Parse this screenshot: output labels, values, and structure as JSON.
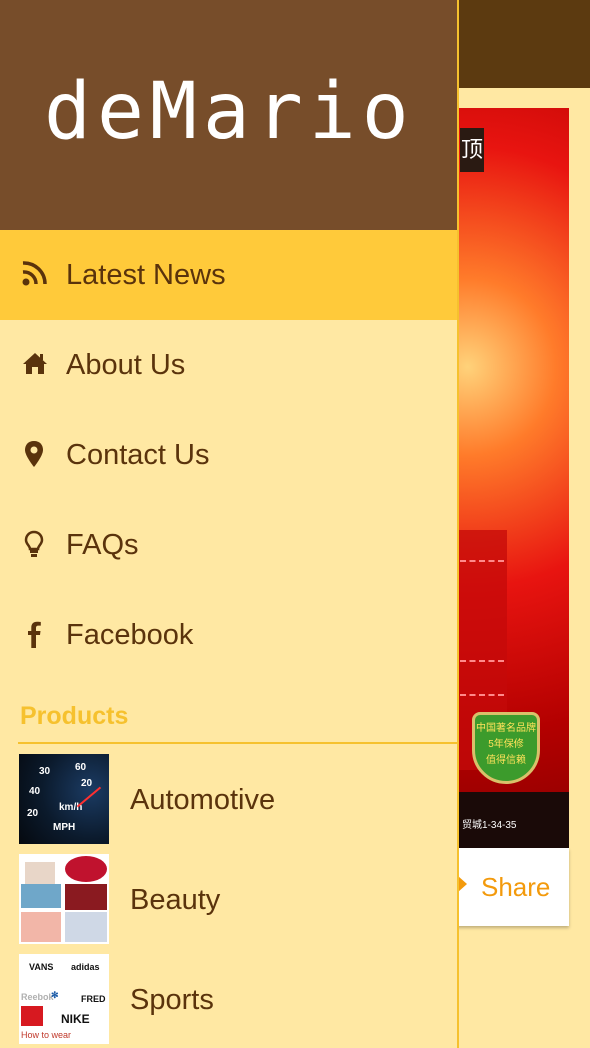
{
  "brand": {
    "logo_text": "deMario"
  },
  "nav": {
    "items": [
      {
        "label": "Latest News",
        "icon": "rss-icon",
        "active": true
      },
      {
        "label": "About Us",
        "icon": "home-icon",
        "active": false
      },
      {
        "label": "Contact Us",
        "icon": "map-marker-icon",
        "active": false
      },
      {
        "label": "FAQs",
        "icon": "lightbulb-icon",
        "active": false
      },
      {
        "label": "Facebook",
        "icon": "facebook-icon",
        "active": false
      }
    ]
  },
  "products": {
    "title": "Products",
    "items": [
      {
        "label": "Automotive",
        "thumb": "speedometer-image"
      },
      {
        "label": "Beauty",
        "thumb": "beauty-collage-image"
      },
      {
        "label": "Sports",
        "thumb": "sports-brands-image"
      }
    ]
  },
  "background": {
    "share_label": "Share",
    "banner_bottom_text": "贸城1-34-35",
    "shield_text": [
      "中国著名品牌",
      "5年保修",
      "值得信赖"
    ]
  },
  "colors": {
    "drawer_bg": "#ffe8a3",
    "logo_bg": "#774d2a",
    "active_item": "#ffca3a",
    "text_brown": "#5a330c",
    "accent_yellow": "#f6c12e",
    "share_orange": "#f39a0c",
    "header_dark": "#5c3a10"
  }
}
